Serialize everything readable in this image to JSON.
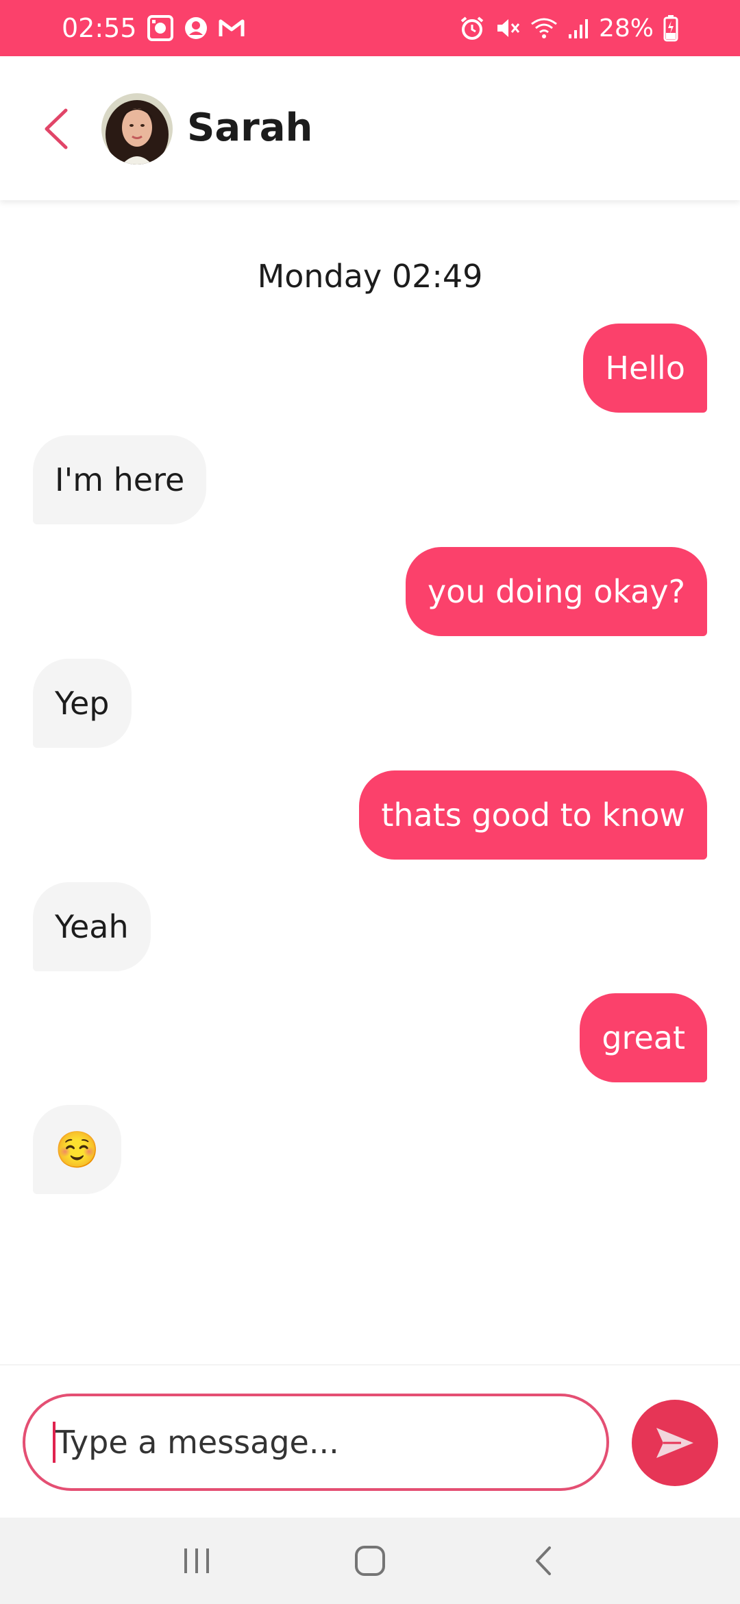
{
  "status_bar": {
    "time": "02:55",
    "battery": "28%",
    "left_icons": [
      "screen-record-icon",
      "account-icon",
      "gmail-icon"
    ],
    "right_icons": [
      "alarm-icon",
      "mute-icon",
      "wifi-icon",
      "signal-icon",
      "battery-charging-icon"
    ]
  },
  "header": {
    "contact_name": "Sarah",
    "back_icon": "chevron-left-icon",
    "avatar": "contact-avatar"
  },
  "chat": {
    "timestamp": "Monday 02:49",
    "messages": [
      {
        "direction": "out",
        "text": "Hello"
      },
      {
        "direction": "in",
        "text": "I'm here"
      },
      {
        "direction": "out",
        "text": "you doing okay?"
      },
      {
        "direction": "in",
        "text": "Yep"
      },
      {
        "direction": "out",
        "text": "thats good to know"
      },
      {
        "direction": "in",
        "text": "Yeah"
      },
      {
        "direction": "out",
        "text": "great"
      },
      {
        "direction": "in",
        "text": "☺️"
      }
    ]
  },
  "composer": {
    "placeholder": "Type a message...",
    "send_icon": "send-icon"
  },
  "nav_bar": {
    "items": [
      "recent-apps-icon",
      "home-icon",
      "back-icon"
    ]
  },
  "colors": {
    "accent": "#fb416b",
    "send_button": "#e63556",
    "incoming_bubble": "#f4f4f4"
  }
}
